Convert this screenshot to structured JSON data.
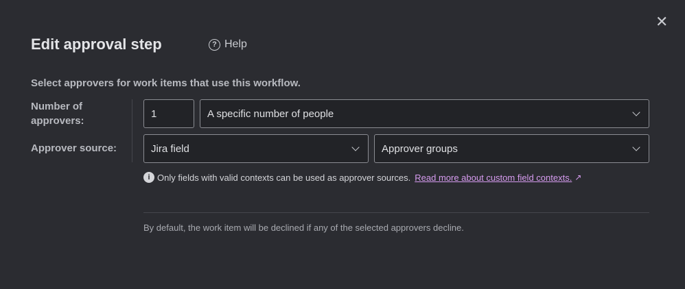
{
  "dialog": {
    "title": "Edit approval step",
    "help_label": "Help",
    "subtitle": "Select approvers for work items that use this workflow.",
    "number_label": "Number of approvers:",
    "number_value": "1",
    "number_mode": "A specific number of people",
    "source_label": "Approver source:",
    "source_type": "Jira field",
    "source_field": "Approver groups",
    "info_text": "Only fields with valid contexts can be used as approver sources.",
    "info_link": "Read more about custom field contexts.",
    "footer_note": "By default, the work item will be declined if any of the selected approvers decline."
  }
}
